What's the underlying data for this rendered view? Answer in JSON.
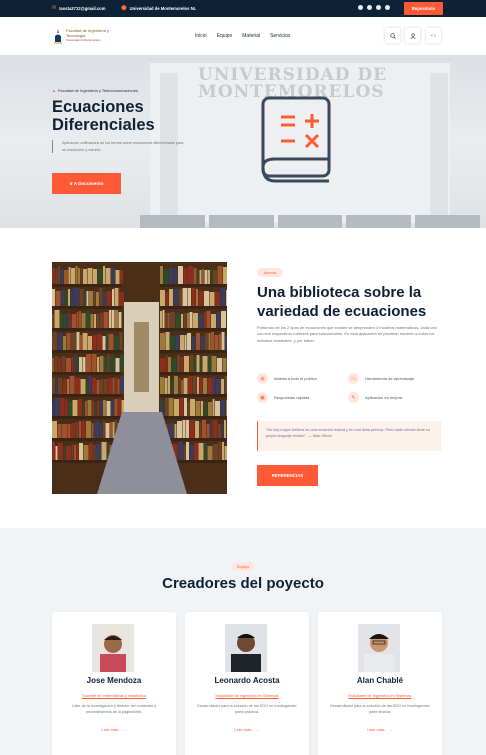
{
  "topbar": {
    "email": "Iaosta3712@gmail.com",
    "location": "Universidad de Montemorelos NL",
    "repo_label": "Repositorio",
    "social_icons": [
      "facebook-icon",
      "twitter-icon",
      "linkedin-icon",
      "instagram-icon"
    ]
  },
  "navbar": {
    "logo_line1": "Facultad de Ingeniería y Tecnología",
    "logo_line2": "Universidad de Montemorelos",
    "menu": [
      "Inicio",
      "Equipo",
      "Material",
      "Servicios"
    ],
    "icons": [
      "search-icon",
      "user-icon",
      "code-icon"
    ]
  },
  "hero": {
    "faculty": "Facultad de Ingeniería y Telecomunicaciones",
    "title": "Ecuaciones Diferenciales",
    "description": "Aplicación unificadora de los temas sobre ecuaciones diferenciales para su resolución y estudio.",
    "cta": "Ir A Documento",
    "building_text": "UNIVERSIDAD DE MONTEMORELOS",
    "accent": "#ff5a36"
  },
  "about": {
    "badge": "Acerca",
    "title": "Una biblioteca sobre la variedad de ecuaciones",
    "text": "Partiendo de los 2 tipos de ecuaciones que existen se desprenden 4 modelos matemáticos, cada uno con sus respectivos métodos para solucionarlos. En esta aplicación se plantean resolver a todos los métodos existentes, y por haber.",
    "features": [
      {
        "icon": "globe-icon",
        "label": "Abierta a todo el público"
      },
      {
        "icon": "chat-icon",
        "label": "Herramienta de aprendizaje"
      },
      {
        "icon": "inbox-icon",
        "label": "Respuestas rapidas"
      },
      {
        "icon": "hammer-icon",
        "label": "Aplicación en mejora"
      }
    ],
    "quote": "\"No hay mayor belleza en una ecuación exacta y en una llana precisa. Pero cada ciencia tiene su propio lenguaje erótico\". — Marc Bloch",
    "button": "REFERENCIAS"
  },
  "team": {
    "badge": "Equipo",
    "title": "Creadores del poyecto",
    "members": [
      {
        "name": "Jose Mendoza",
        "role": "Docente en matemáticas y estadística",
        "bio": "Líder de la investigación y director del contenido y procedimientos de la páginaWeb.",
        "more": "Leer más..."
      },
      {
        "name": "Leonardo Acosta",
        "role": "Estudiante de Ingeniería en Sistemas",
        "bio": "Desarrollador para la solución de las EDO en frontingeneer parte práctica.",
        "more": "Leer más..."
      },
      {
        "name": "Alan Chablé",
        "role": "Estudiante de Ingeniería en Sistemas",
        "bio": "Desarrollador para la solución de las EDO en frontingeneer parte teórica.",
        "more": "Leer más..."
      }
    ]
  }
}
